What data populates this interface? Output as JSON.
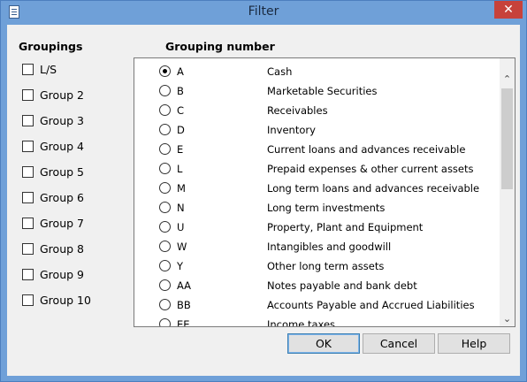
{
  "window": {
    "title": "Filter",
    "close_glyph": "✕"
  },
  "groupings": {
    "heading": "Groupings",
    "items": [
      "L/S",
      "Group 2",
      "Group 3",
      "Group 4",
      "Group 5",
      "Group 6",
      "Group 7",
      "Group 8",
      "Group 9",
      "Group 10"
    ]
  },
  "grouping_number": {
    "heading": "Grouping number",
    "selected": "A",
    "rows": [
      {
        "code": "A",
        "desc": "Cash"
      },
      {
        "code": "B",
        "desc": "Marketable Securities"
      },
      {
        "code": "C",
        "desc": "Receivables"
      },
      {
        "code": "D",
        "desc": "Inventory"
      },
      {
        "code": "E",
        "desc": "Current loans and advances receivable"
      },
      {
        "code": "L",
        "desc": "Prepaid expenses & other current assets"
      },
      {
        "code": "M",
        "desc": "Long term loans and advances receivable"
      },
      {
        "code": "N",
        "desc": "Long term investments"
      },
      {
        "code": "U",
        "desc": "Property, Plant and Equipment"
      },
      {
        "code": "W",
        "desc": "Intangibles and goodwill"
      },
      {
        "code": "Y",
        "desc": "Other long term assets"
      },
      {
        "code": "AA",
        "desc": "Notes payable and bank debt"
      },
      {
        "code": "BB",
        "desc": "Accounts Payable and Accrued Liabilities"
      },
      {
        "code": "EE",
        "desc": "Income taxes"
      }
    ]
  },
  "buttons": {
    "ok": "OK",
    "cancel": "Cancel",
    "help": "Help"
  },
  "scroll": {
    "up": "⌃",
    "down": "⌄"
  }
}
